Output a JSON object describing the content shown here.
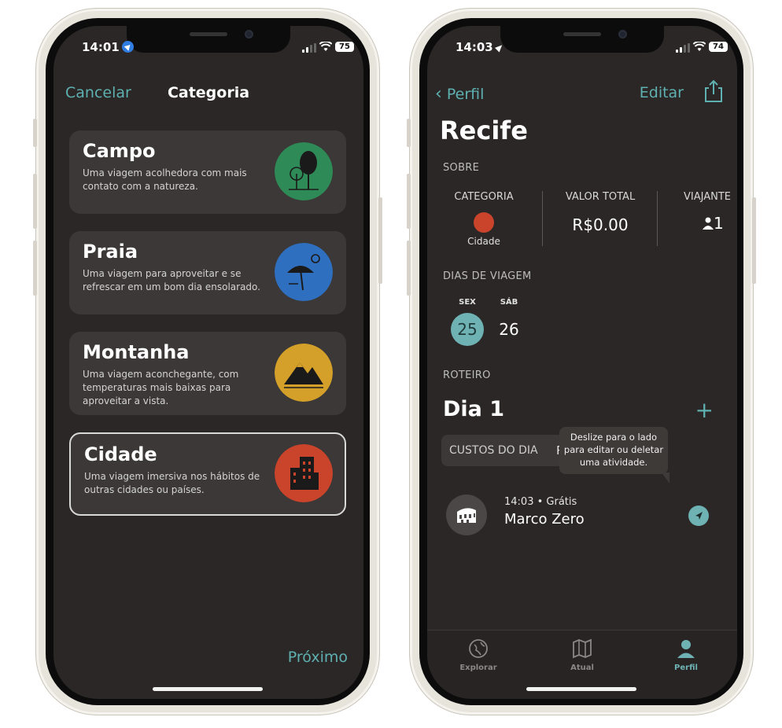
{
  "left_phone": {
    "status": {
      "time": "14:01",
      "battery": "75"
    },
    "nav": {
      "cancel_label": "Cancelar",
      "title": "Categoria"
    },
    "categories": [
      {
        "title": "Campo",
        "description": "Uma viagem acolhedora com mais contato com a natureza.",
        "color": "#2e8b57",
        "icon": "trees-icon",
        "selected": false
      },
      {
        "title": "Praia",
        "description": "Uma viagem para aproveitar e se refrescar em um bom dia ensolarado.",
        "color": "#2f6fbf",
        "icon": "beach-umbrella-icon",
        "selected": false
      },
      {
        "title": "Montanha",
        "description": "Uma viagem aconchegante, com temperaturas mais baixas para aproveitar a vista.",
        "color": "#d4a02a",
        "icon": "mountain-icon",
        "selected": false
      },
      {
        "title": "Cidade",
        "description": "Uma viagem imersiva nos hábitos de outras cidades ou países.",
        "color": "#c9442a",
        "icon": "buildings-icon",
        "selected": true
      }
    ],
    "next_label": "Próximo"
  },
  "right_phone": {
    "status": {
      "time": "14:03",
      "battery": "74"
    },
    "nav": {
      "back_label": "Perfil",
      "edit_label": "Editar",
      "share_icon": "share-icon"
    },
    "trip_title": "Recife",
    "about": {
      "section_label": "SOBRE",
      "category_label": "CATEGORIA",
      "category_value": "Cidade",
      "category_color": "#c9442a",
      "total_label": "VALOR TOTAL",
      "total_value": "R$0.00",
      "travelers_label": "VIAJANTE",
      "travelers_value": "1"
    },
    "days": {
      "section_label": "DIAS DE VIAGEM",
      "items": [
        {
          "dow": "SEX",
          "num": "25",
          "selected": true
        },
        {
          "dow": "SÁB",
          "num": "26",
          "selected": false
        }
      ]
    },
    "itinerary": {
      "section_label": "ROTEIRO",
      "day_title": "Dia 1",
      "costs_label": "CUSTOS DO DIA",
      "costs_value_partial": "R",
      "tooltip": "Deslize para o lado para editar ou deletar uma atividade.",
      "activity": {
        "meta": "14:03 • Grátis",
        "name": "Marco Zero",
        "icon": "colosseum-icon"
      }
    },
    "tabs": [
      {
        "label": "Explorar",
        "icon": "globe-icon",
        "active": false
      },
      {
        "label": "Atual",
        "icon": "map-icon",
        "active": false
      },
      {
        "label": "Perfil",
        "icon": "person-icon",
        "active": true
      }
    ],
    "accent": "#6fb2b4"
  }
}
